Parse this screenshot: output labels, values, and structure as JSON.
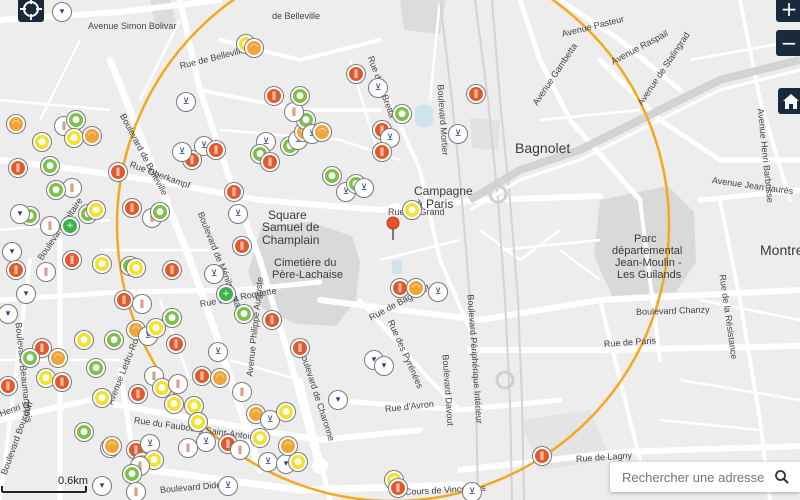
{
  "colors": {
    "radius_circle": "#f2a91f",
    "park": "#d7d9d7",
    "map_bg": "#ededed",
    "road": "#ffffff",
    "control_bg": "#1b2a3b",
    "marker_pin": "#e8532b"
  },
  "places": {
    "bagnolet": "Bagnolet",
    "campagne": "Campagne",
    "campagne2": "à Paris",
    "square1": "Square",
    "square2": "Samuel de",
    "square3": "Champlain",
    "cimetiere1": "Cimetière du",
    "cimetiere2": "Père-Lachaise",
    "parc1": "Parc",
    "parc2": "départemental",
    "parc3": "Jean-Moulin -",
    "parc4": "Les Guilands",
    "montreuil": "Montre"
  },
  "streets": {
    "simon_bolivar": "Avenue Simon Bolivar",
    "de_belleville_top": "de Belleville",
    "bd_belleville": "Boulevard de Belleville",
    "oberkampf": "Rue Oberkampf",
    "voltaire": "Boulevard Voltaire",
    "menilmontant": "Boulevard de Ménilmontant",
    "roquette": "Rue de la Roquette",
    "ledru": "Avenue Ledru-Rollin",
    "beaumarchais": "Boulevard Beaumarchais",
    "henri_iv": "Henri IV",
    "bourdon": "Boulevard Bourdon",
    "faubourg": "Rue du Faubourg Saint-Antoine",
    "diderot": "Boulevard Diderot",
    "philippe_auguste": "Avenue Philippe Auguste",
    "charonne": "Boulevard de Charonne",
    "avron": "Rue d'Avron",
    "vincennes": "Cours de Vincennes",
    "pyrenees": "Rue des Pyrénées",
    "bagnolet_rue": "Rue de Bagnolet",
    "bd_mortier": "Boulevard Mortier",
    "bd_davout": "Boulevard Davout",
    "peripherique": "Boulevard Périphérique Intérieur",
    "rue_paris": "Rue de Paris",
    "chanzy": "Boulevard Chanzy",
    "lagny": "Rue de Lagny",
    "pasteur": "Avenue Pasteur",
    "raspail": "Avenue Raspail",
    "gambetta": "Avenue Gambetta",
    "stalingrad": "Avenue de Stalingrad",
    "henri_barbusse": "Avenue Henri Barbusse",
    "jean_jaures": "Avenue Jean Jaurès",
    "resistance": "Rue de la Résistance",
    "rue_grand": "Rue du Grand",
    "ta": "Rue de Ta",
    "dela": "de la",
    "belleville_r": "Rue de Belleville",
    "leon_gaumont": "Rue L. Gaumont",
    "bretta": "Rue de la Bretta"
  },
  "controls": {
    "zoom_in": "+",
    "zoom_out": "−",
    "locate_icon": "crosshair-icon",
    "home_icon": "home-icon"
  },
  "search": {
    "placeholder": "Rechercher une adresse",
    "icon": "search-icon"
  },
  "scale": {
    "label": "0.6km"
  },
  "marker": {
    "icon": "map-pin-icon"
  },
  "legend_icons": {
    "blue": "shopping-cart-icon",
    "red": "restaurant-icon",
    "orange": "bakery-icon",
    "green": "grocery-icon",
    "yellow": "fruit-icon",
    "brown": "butcher-icon",
    "cross": "pharmacy-icon",
    "navy": "fishmonger-icon"
  }
}
